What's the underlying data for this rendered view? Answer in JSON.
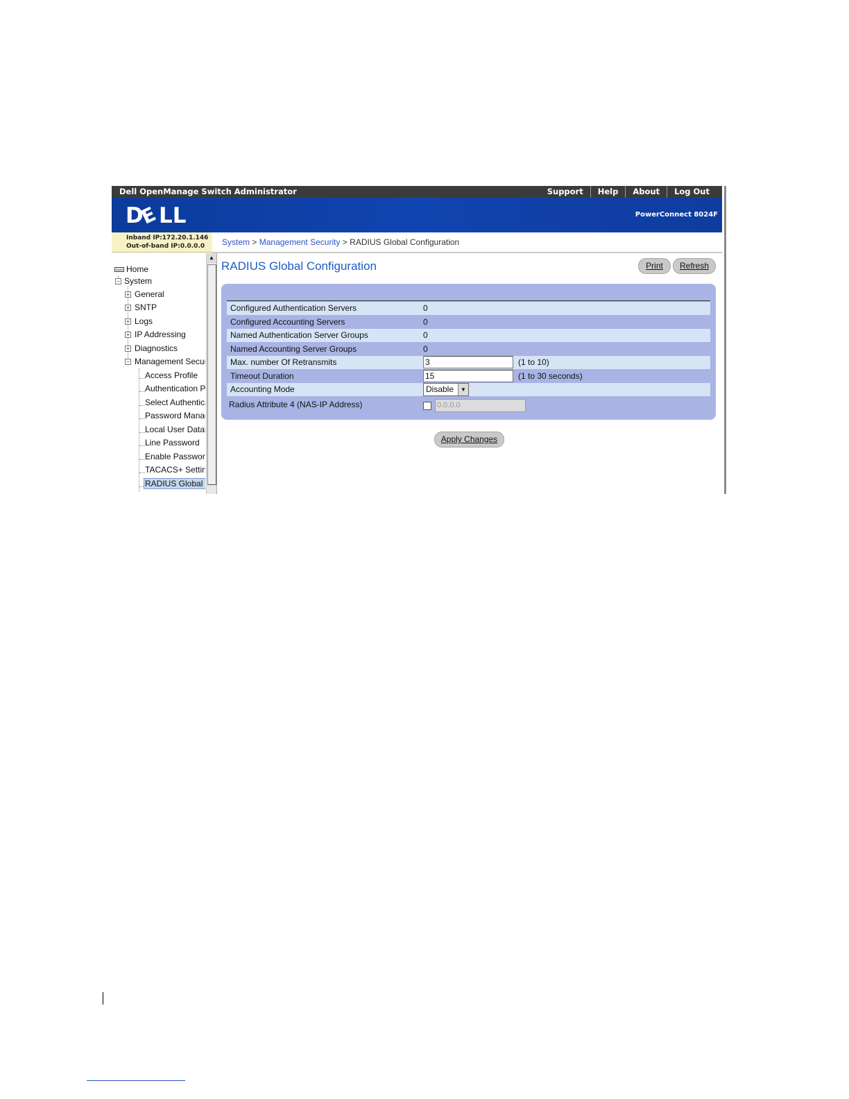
{
  "titlebar": {
    "app_title": "Dell OpenManage Switch Administrator",
    "links": [
      "Support",
      "Help",
      "About",
      "Log Out"
    ]
  },
  "banner": {
    "logo_text": "DELL",
    "model": "PowerConnect 8024F",
    "color": "#0b3b9b"
  },
  "ip_info": {
    "inband": "Inband IP:172.20.1.146",
    "out_of_band": "Out-of-band IP:0.0.0.0"
  },
  "breadcrumb": {
    "items": [
      "System",
      "Management Security",
      "RADIUS Global Configuration"
    ],
    "separator": ">"
  },
  "sidebar": {
    "home": "Home",
    "system": "System",
    "groups": [
      "General",
      "SNTP",
      "Logs",
      "IP Addressing",
      "Diagnostics",
      "Management Securi"
    ],
    "mgmt_items": [
      "Access Profile",
      "Authentication Pr",
      "Select Authentica",
      "Password Manag",
      "Local User Datab",
      "Line Password",
      "Enable Password",
      "TACACS+ Settin",
      "RADIUS Global C"
    ]
  },
  "main": {
    "title": "RADIUS Global Configuration",
    "print_label": "Print",
    "refresh_label": "Refresh",
    "rows": {
      "auth_servers": {
        "label": "Configured Authentication Servers",
        "value": "0"
      },
      "acct_servers": {
        "label": "Configured Accounting Servers",
        "value": "0"
      },
      "named_auth_groups": {
        "label": "Named Authentication Server Groups",
        "value": "0"
      },
      "named_acct_groups": {
        "label": "Named Accounting Server Groups",
        "value": "0"
      },
      "retransmits": {
        "label": "Max. number Of Retransmits",
        "value": "3",
        "hint": "(1 to 10)"
      },
      "timeout": {
        "label": "Timeout Duration",
        "value": "15",
        "hint": "(1 to 30 seconds)"
      },
      "accounting_mode": {
        "label": "Accounting Mode",
        "value": "Disable"
      },
      "nas_ip": {
        "label": "Radius Attribute 4 (NAS-IP Address)",
        "checked": false,
        "value": "0.0.0.0"
      }
    },
    "apply_label": "Apply Changes",
    "accent_color": "#1e5cc4",
    "panel_color": "#a9b4e4"
  }
}
